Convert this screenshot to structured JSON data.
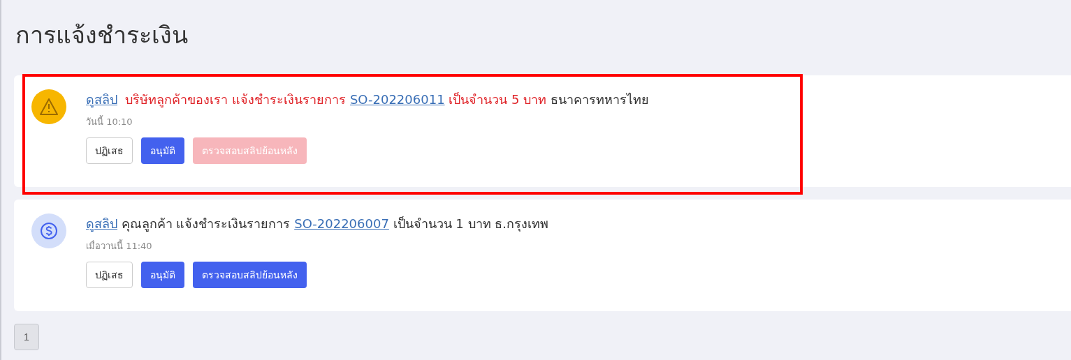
{
  "page": {
    "title": "การแจ้งชำระเงิน"
  },
  "notifications": [
    {
      "kind": "warning",
      "highlighted": true,
      "message": {
        "view_link": "ดูสลิป",
        "before": "บริษัทลูกค้าของเรา แจ้งชำระเงินรายการ",
        "order": "SO-202206011",
        "after": "เป็นจำนวน 5 บาท",
        "bank": "ธนาคารทหารไทย"
      },
      "time": "วันนี้ 10:10",
      "buttons": [
        {
          "kind": "reject",
          "label": "ปฏิเสธ",
          "disabled": false
        },
        {
          "kind": "approve",
          "label": "อนุมัติ",
          "disabled": false
        },
        {
          "kind": "verify",
          "label": "ตรวจสอบสลิปย้อนหลัง",
          "disabled": true
        }
      ]
    },
    {
      "kind": "payment",
      "highlighted": false,
      "message": {
        "view_link": "ดูสลิป",
        "before": "คุณลูกค้า แจ้งชำระเงินรายการ",
        "order": "SO-202206007",
        "after": "เป็นจำนวน 1 บาท",
        "bank": "ธ.กรุงเทพ"
      },
      "time": "เมื่อวานนี้ 11:40",
      "buttons": [
        {
          "kind": "reject",
          "label": "ปฏิเสธ",
          "disabled": false
        },
        {
          "kind": "approve",
          "label": "อนุมัติ",
          "disabled": false
        },
        {
          "kind": "verify",
          "label": "ตรวจสอบสลิปย้อนหลัง",
          "disabled": false
        }
      ]
    }
  ],
  "pagination": [
    {
      "label": "1",
      "selected": true
    }
  ]
}
